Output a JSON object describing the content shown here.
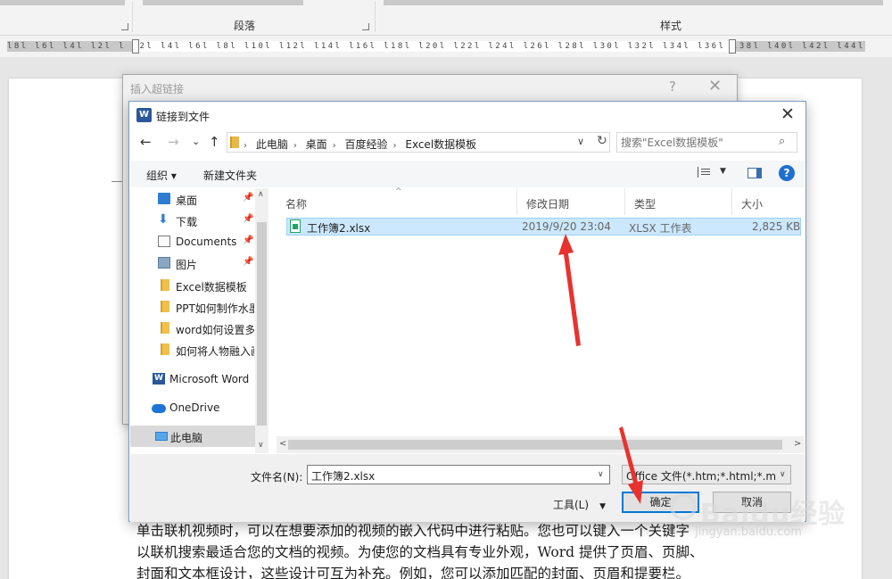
{
  "ribbon": {
    "paragraph_group": "段落",
    "styles_group": "样式"
  },
  "ruler": {
    "ticks": "l8l l6l l4l l2l   l l2l l4l l6l l8l l10l l12l l14l l16l l18l l20l l22l l24l l26l l28l l30l l32l l34l l36l l38l  l40l l42l l44l l46l l48"
  },
  "document": {
    "lines": [
      "单击联机视频时，可以在想要添加的视频的嵌入代码中进行粘贴。您也可以键入一个关键字",
      "以联机搜索最适合您的文档的视频。为使您的文档具有专业外观，Word 提供了页眉、页脚、",
      "封面和文本框设计，这些设计可互为补充。例如，您可以添加匹配的封面、页眉和提要栏。"
    ]
  },
  "hyperlink_dialog": {
    "title": "插入超链接",
    "help": "?",
    "close": "✕"
  },
  "file_dialog": {
    "logo": "W",
    "title": "链接到文件",
    "close": "✕",
    "nav": {
      "back": "←",
      "forward": "→",
      "recent": "⌄",
      "up": "↑"
    },
    "breadcrumb": [
      "此电脑",
      "桌面",
      "百度经验",
      "Excel数据模板"
    ],
    "search_placeholder": "搜索\"Excel数据模板\"",
    "toolbar": {
      "organize": "组织 ▾",
      "new_folder": "新建文件夹",
      "help": "?"
    },
    "nav_items": [
      {
        "label": "桌面",
        "icon": "desktop-icon",
        "pinned": true
      },
      {
        "label": "下载",
        "icon": "download-icon",
        "pinned": true
      },
      {
        "label": "Documents",
        "icon": "documents-icon",
        "pinned": true
      },
      {
        "label": "图片",
        "icon": "pictures-icon",
        "pinned": true
      },
      {
        "label": "Excel数据模板",
        "icon": "folder-icon",
        "pinned": false
      },
      {
        "label": "PPT如何制作水墨",
        "icon": "folder-icon",
        "pinned": false
      },
      {
        "label": "word如何设置多",
        "icon": "folder-icon",
        "pinned": false
      },
      {
        "label": "如何将人物融入画",
        "icon": "folder-icon",
        "pinned": false
      },
      {
        "label": "Microsoft Word",
        "icon": "word-icon",
        "pinned": false
      },
      {
        "label": "OneDrive",
        "icon": "onedrive-icon",
        "pinned": false
      },
      {
        "label": "此电脑",
        "icon": "this-pc-icon",
        "pinned": false
      }
    ],
    "pin_glyph": "📌",
    "columns": {
      "name": "名称",
      "modified": "修改日期",
      "type": "类型",
      "size": "大小"
    },
    "files": [
      {
        "name": "工作簿2.xlsx",
        "modified": "2019/9/20 23:04",
        "type": "XLSX 工作表",
        "size": "2,825 KB"
      }
    ],
    "filename_label": "文件名(N):",
    "filename_value": "工作簿2.xlsx",
    "filter_value": "Office 文件(*.htm;*.html;*.mht",
    "tools_label": "工具(L)",
    "ok_label": "确定",
    "cancel_label": "取消"
  },
  "watermark": {
    "brand": "Baidu经验",
    "url": "jingyan.baidu.com"
  },
  "colors": {
    "selection": "#cce8ff",
    "accent": "#0078d7",
    "annotation_arrow": "#e8322f"
  }
}
